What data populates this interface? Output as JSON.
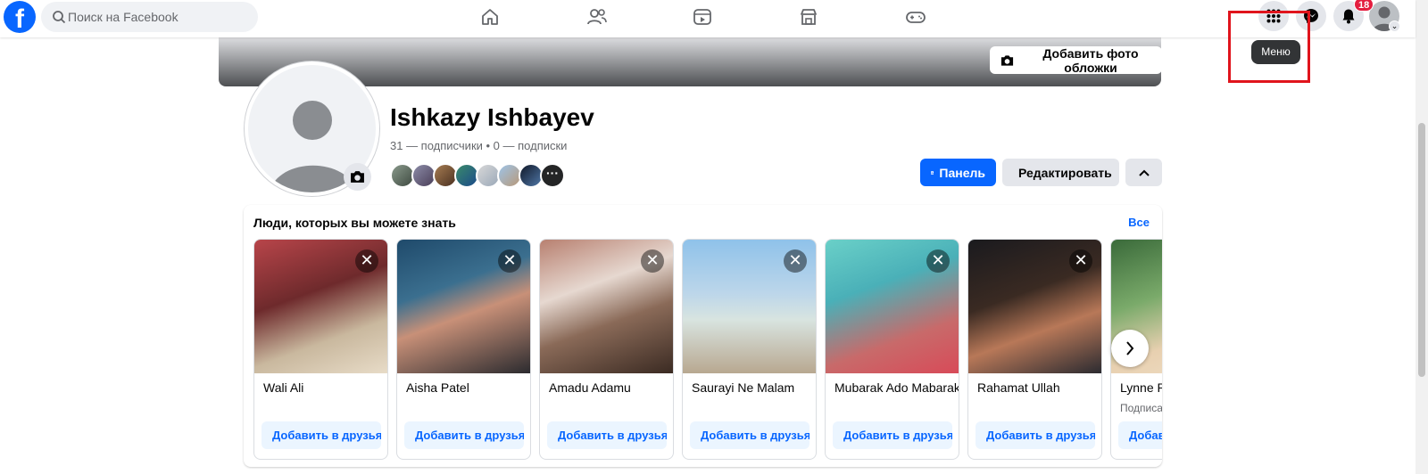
{
  "header": {
    "logo_letter": "f",
    "search_placeholder": "Поиск на Facebook",
    "nav_icons": [
      "home-icon",
      "friends-icon",
      "video-icon",
      "marketplace-icon",
      "gaming-icon"
    ],
    "notifications_badge": "18",
    "tooltip": "Меню"
  },
  "cover": {
    "add_cover_label": "Добавить фото обложки"
  },
  "profile": {
    "name": "Ishkazy Ishbayev",
    "stats": "31 — подписчики • 0 — подписки",
    "panel_label": "Панель",
    "edit_label": "Редактировать"
  },
  "pymk": {
    "title": "Люди, которых вы можете знать",
    "see_all": "Все",
    "people": [
      {
        "name": "Wali Ali",
        "sub": "",
        "add_label": "Добавить в друзья"
      },
      {
        "name": "Aisha Patel",
        "sub": "",
        "add_label": "Добавить в друзья"
      },
      {
        "name": "Amadu Adamu",
        "sub": "",
        "add_label": "Добавить в друзья"
      },
      {
        "name": "Saurayi Ne Malam",
        "sub": "",
        "add_label": "Добавить в друзья"
      },
      {
        "name": "Mubarak Ado Mabarak",
        "sub": "",
        "add_label": "Добавить в друзья"
      },
      {
        "name": "Rahamat Ullah",
        "sub": "",
        "add_label": "Добавить в друзья"
      },
      {
        "name": "Lynne Ruth",
        "sub": "Подписаться",
        "add_label": "Добавить в друзья"
      }
    ]
  },
  "colors": {
    "brand": "#0866ff",
    "badge": "#e41e3f",
    "highlight": "#e0141c"
  }
}
